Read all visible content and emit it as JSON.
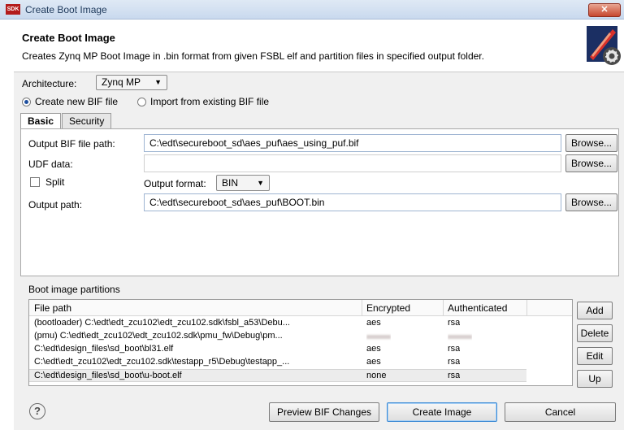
{
  "window": {
    "title": "Create Boot Image",
    "app_icon_text": "SDK",
    "close_symbol": "✕"
  },
  "header": {
    "title": "Create Boot Image",
    "description": "Creates Zynq MP Boot Image in .bin format from given FSBL elf and partition files in specified output folder.",
    "icon": "gear-icon"
  },
  "architecture": {
    "label": "Architecture:",
    "selected": "Zynq MP"
  },
  "bif_mode": {
    "create_label": "Create new BIF file",
    "import_label": "Import from existing BIF file",
    "selected": "create"
  },
  "tabs": [
    {
      "label": "Basic",
      "active": true
    },
    {
      "label": "Security",
      "active": false
    }
  ],
  "basic": {
    "output_bif_label": "Output BIF file path:",
    "output_bif_value": "C:\\edt\\secureboot_sd\\aes_puf\\aes_using_puf.bif",
    "udf_label": "UDF data:",
    "udf_value": "",
    "split_label": "Split",
    "split_checked": false,
    "output_format_label": "Output format:",
    "output_format_value": "BIN",
    "output_path_label": "Output path:",
    "output_path_value": "C:\\edt\\secureboot_sd\\aes_puf\\BOOT.bin",
    "browse_label": "Browse..."
  },
  "partitions": {
    "label": "Boot image partitions",
    "columns": [
      "File path",
      "Encrypted",
      "Authenticated"
    ],
    "rows": [
      {
        "path": "(bootloader) C:\\edt\\edt_zcu102\\edt_zcu102.sdk\\fsbl_a53\\Debu...",
        "encrypted": "aes",
        "authenticated": "rsa"
      },
      {
        "path": "(pmu) C:\\edt\\edt_zcu102\\edt_zcu102.sdk\\pmu_fw\\Debug\\pm...",
        "encrypted": "",
        "authenticated": ""
      },
      {
        "path": "C:\\edt\\design_files\\sd_boot\\bl31.elf",
        "encrypted": "aes",
        "authenticated": "rsa"
      },
      {
        "path": "C:\\edt\\edt_zcu102\\edt_zcu102.sdk\\testapp_r5\\Debug\\testapp_...",
        "encrypted": "aes",
        "authenticated": "rsa"
      },
      {
        "path": "C:\\edt\\design_files\\sd_boot\\u-boot.elf",
        "encrypted": "none",
        "authenticated": "rsa"
      }
    ],
    "selected_row": 4,
    "buttons": {
      "add": "Add",
      "delete": "Delete",
      "edit": "Edit",
      "up": "Up"
    }
  },
  "footer": {
    "help_symbol": "?",
    "preview_label": "Preview BIF Changes",
    "create_label": "Create Image",
    "cancel_label": "Cancel"
  }
}
